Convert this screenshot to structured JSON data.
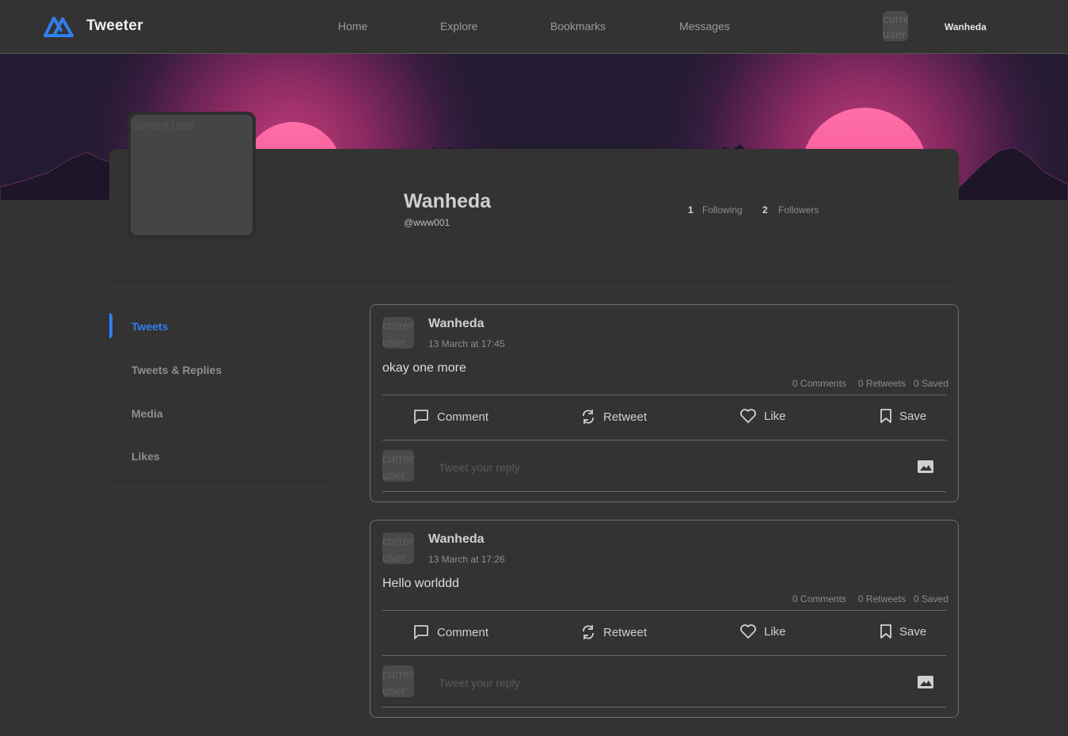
{
  "header": {
    "brand": "Tweeter",
    "nav": [
      "Home",
      "Explore",
      "Bookmarks",
      "Messages"
    ],
    "avatar_alt": "current user",
    "user_name": "Wanheda"
  },
  "profile": {
    "avatar_alt": "current user",
    "name": "Wanheda",
    "handle": "@www001",
    "following_count": "1",
    "following_label": "Following",
    "followers_count": "2",
    "followers_label": "Followers"
  },
  "sidebar": {
    "items": [
      "Tweets",
      "Tweets & Replies",
      "Media",
      "Likes"
    ],
    "active": "Tweets"
  },
  "tweets": [
    {
      "avatar_alt": "current user",
      "author": "Wanheda",
      "date": "13 March at 17:45",
      "text": "okay one more",
      "comments": "0 Comments",
      "retweets": "0 Retweets",
      "saved": "0 Saved",
      "actions": {
        "comment": "Comment",
        "retweet": "Retweet",
        "like": "Like",
        "save": "Save"
      },
      "reply_avatar_alt": "current user",
      "reply_placeholder": "Tweet your reply"
    },
    {
      "avatar_alt": "current user",
      "author": "Wanheda",
      "date": "13 March at 17:26",
      "text": "Hello worlddd",
      "comments": "0 Comments",
      "retweets": "0 Retweets",
      "saved": "0 Saved",
      "actions": {
        "comment": "Comment",
        "retweet": "Retweet",
        "like": "Like",
        "save": "Save"
      },
      "reply_avatar_alt": "current user",
      "reply_placeholder": "Tweet your reply"
    }
  ],
  "colors": {
    "background": "#333333",
    "accent": "#2f80ed",
    "text_primary": "#d0d0d0",
    "text_muted": "#8e8e8e"
  }
}
